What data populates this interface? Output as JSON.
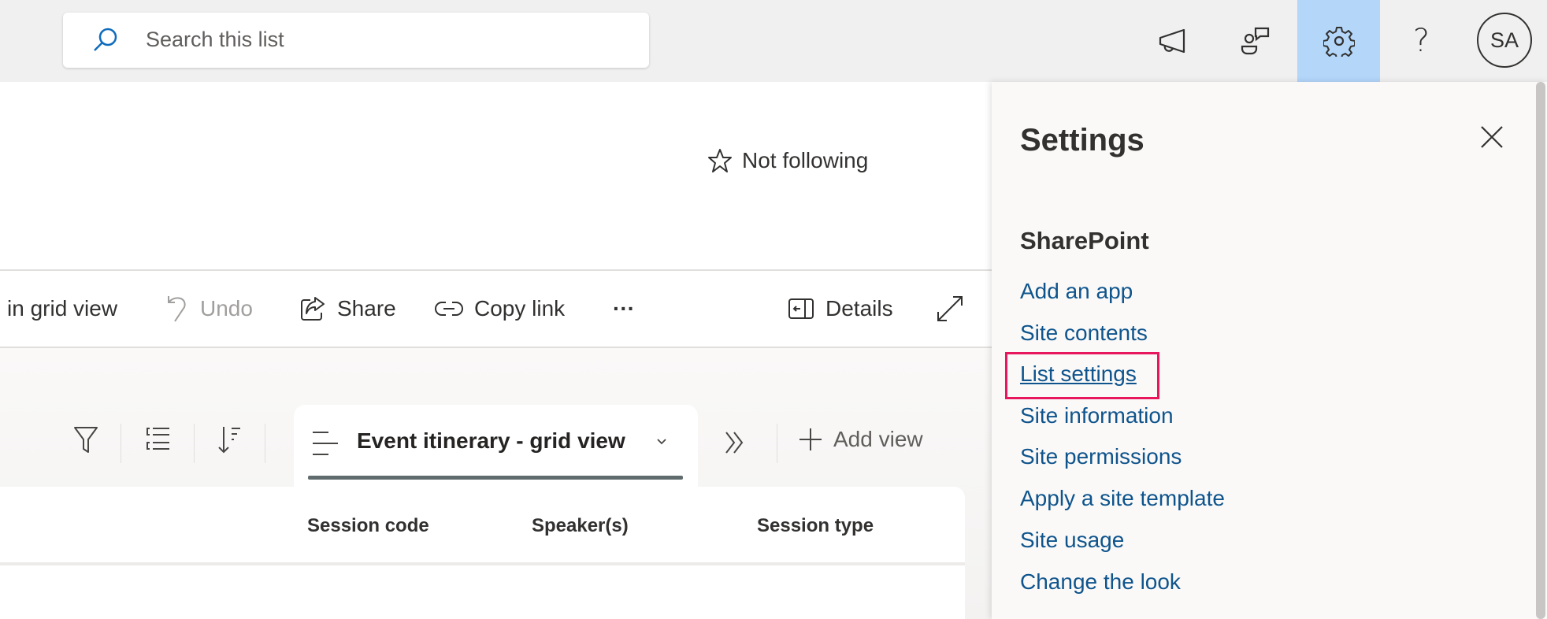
{
  "topbar": {
    "search_placeholder": "Search this list",
    "avatar_initials": "SA"
  },
  "header": {
    "follow_label": "Not following"
  },
  "command_bar": {
    "edit_grid": "in grid view",
    "undo": "Undo",
    "share": "Share",
    "copy_link": "Copy link",
    "more": "···",
    "details": "Details"
  },
  "views": {
    "current_view": "Event itinerary - grid view",
    "add_view": "Add view"
  },
  "grid": {
    "columns": [
      "Session code",
      "Speaker(s)",
      "Session type"
    ]
  },
  "settings_panel": {
    "title": "Settings",
    "section": "SharePoint",
    "links": [
      "Add an app",
      "Site contents",
      "List settings",
      "Site information",
      "Site permissions",
      "Apply a site template",
      "Site usage",
      "Change the look"
    ]
  },
  "colors": {
    "link": "#0f548c",
    "highlight": "#e8175d",
    "active_tab_bg": "#b3d6f9"
  }
}
